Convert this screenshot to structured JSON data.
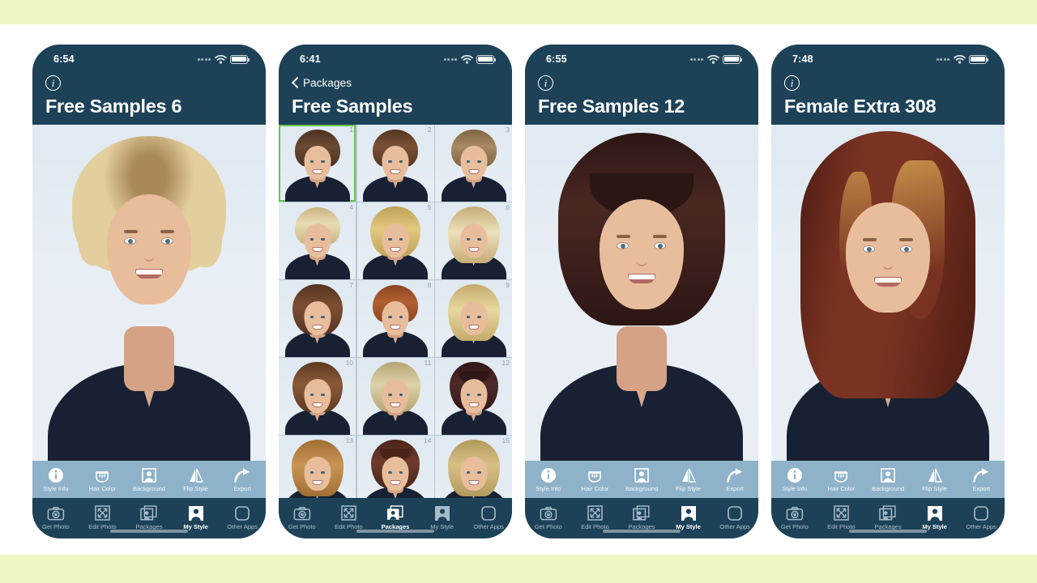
{
  "page": {
    "background_color": "#eef7c4",
    "canvas_color": "#ffffff",
    "accent_color": "#1d4258",
    "action_bar_color": "#8eb2c9",
    "selection_color": "#6cc24a"
  },
  "icons": {
    "info": "info-circle-icon",
    "back_chevron": "chevron-left-icon",
    "wifi": "wifi-icon",
    "battery": "battery-icon",
    "signal": "signal-dots-icon",
    "style_info": "info-circle-icon",
    "hair_color": "paint-bucket-icon",
    "background": "person-frame-icon",
    "flip_style": "flip-triangle-icon",
    "export": "share-arrow-icon",
    "get_photo": "camera-icon",
    "edit_photo": "crop-expand-icon",
    "packages": "stacked-frames-icon",
    "my_style": "person-filled-icon",
    "other_apps": "rounded-square-icon"
  },
  "action_bar": {
    "items": [
      {
        "label": "Style Info",
        "icon": "info-circle-icon"
      },
      {
        "label": "Hair Color",
        "icon": "paint-bucket-icon"
      },
      {
        "label": "Background",
        "icon": "person-frame-icon"
      },
      {
        "label": "Flip Style",
        "icon": "flip-triangle-icon"
      },
      {
        "label": "Export",
        "icon": "share-arrow-icon"
      }
    ]
  },
  "tab_bar": {
    "items": [
      {
        "label": "Get Photo",
        "icon": "camera-icon"
      },
      {
        "label": "Edit Photo",
        "icon": "crop-expand-icon"
      },
      {
        "label": "Packages",
        "icon": "stacked-frames-icon"
      },
      {
        "label": "My Style",
        "icon": "person-filled-icon"
      },
      {
        "label": "Other Apps",
        "icon": "rounded-square-icon"
      }
    ]
  },
  "screens": [
    {
      "id": "free-samples-6",
      "status_time": "6:54",
      "title": "Free Samples 6",
      "nav_type": "info",
      "back_label": "",
      "view": "portrait",
      "active_tab": "My Style",
      "show_action_bar": true,
      "portrait": {
        "hair_style": "short blonde pixie with side-swept fringe",
        "hair_color": "#e3cf9e",
        "hair_shadow_color": "#a9895a",
        "skin_color": "#e8bd9c",
        "top_color": "#172133",
        "bg_color": "#e4ecf3"
      }
    },
    {
      "id": "free-samples",
      "status_time": "6:41",
      "title": "Free Samples",
      "nav_type": "back",
      "back_label": "Packages",
      "view": "grid",
      "active_tab": "Packages",
      "show_action_bar": false,
      "grid": {
        "columns": 3,
        "selected_index": 1,
        "thumbnails": [
          {
            "n": "1",
            "hair": "#6b4a33",
            "hair2": "#4a3122",
            "style": "spiky-pixie"
          },
          {
            "n": "2",
            "hair": "#7a5136",
            "hair2": "#553522",
            "style": "textured-pixie"
          },
          {
            "n": "3",
            "hair": "#a98a63",
            "hair2": "#7d6442",
            "style": "short-crop"
          },
          {
            "n": "4",
            "hair": "#e8dcb4",
            "hair2": "#c8b383",
            "style": "blonde-pixie"
          },
          {
            "n": "5",
            "hair": "#e3c880",
            "hair2": "#c0a158",
            "style": "blonde-bob"
          },
          {
            "n": "6",
            "hair": "#ece0bb",
            "hair2": "#c5ad78",
            "style": "blonde-layered"
          },
          {
            "n": "7",
            "hair": "#7d4f33",
            "hair2": "#563321",
            "style": "brown-bob"
          },
          {
            "n": "8",
            "hair": "#b35f33",
            "hair2": "#8c4520",
            "style": "copper-pixie"
          },
          {
            "n": "9",
            "hair": "#e8d7a0",
            "hair2": "#c4ab6c",
            "style": "blonde-wavy"
          },
          {
            "n": "10",
            "hair": "#8a5a38",
            "hair2": "#5e3a21",
            "style": "curly-bob"
          },
          {
            "n": "11",
            "hair": "#ddd2a8",
            "hair2": "#b5a575",
            "style": "blonde-curly"
          },
          {
            "n": "12",
            "hair": "#4f2a2a",
            "hair2": "#2f1717",
            "style": "dark-bob-bangs"
          },
          {
            "n": "13",
            "hair": "#c99455",
            "hair2": "#a06f32",
            "style": "shaggy-layers"
          },
          {
            "n": "14",
            "hair": "#6e3b2c",
            "hair2": "#4a2419",
            "style": "auburn-bangs"
          },
          {
            "n": "15",
            "hair": "#d9bf86",
            "hair2": "#b29a5c",
            "style": "blonde-long"
          }
        ]
      }
    },
    {
      "id": "free-samples-12",
      "status_time": "6:55",
      "title": "Free Samples 12",
      "nav_type": "info",
      "back_label": "",
      "view": "portrait",
      "active_tab": "My Style",
      "show_action_bar": true,
      "portrait": {
        "hair_style": "dark brown chin-length bob with full fringe",
        "hair_color": "#4a2822",
        "hair_shadow_color": "#2c1614",
        "skin_color": "#e8bd9c",
        "top_color": "#172133",
        "bg_color": "#e4ecf3"
      }
    },
    {
      "id": "female-extra-308",
      "status_time": "7:48",
      "title": "Female Extra 308",
      "nav_type": "info",
      "back_label": "",
      "view": "portrait",
      "active_tab": "My Style",
      "show_action_bar": true,
      "portrait": {
        "hair_style": "long auburn layers with blonde highlights",
        "hair_color": "#7a3322",
        "hair_shadow_color": "#4d1c14",
        "highlight_color": "#c8924a",
        "skin_color": "#e8bd9c",
        "top_color": "#172133",
        "bg_color": "#e4ecf3"
      }
    }
  ]
}
